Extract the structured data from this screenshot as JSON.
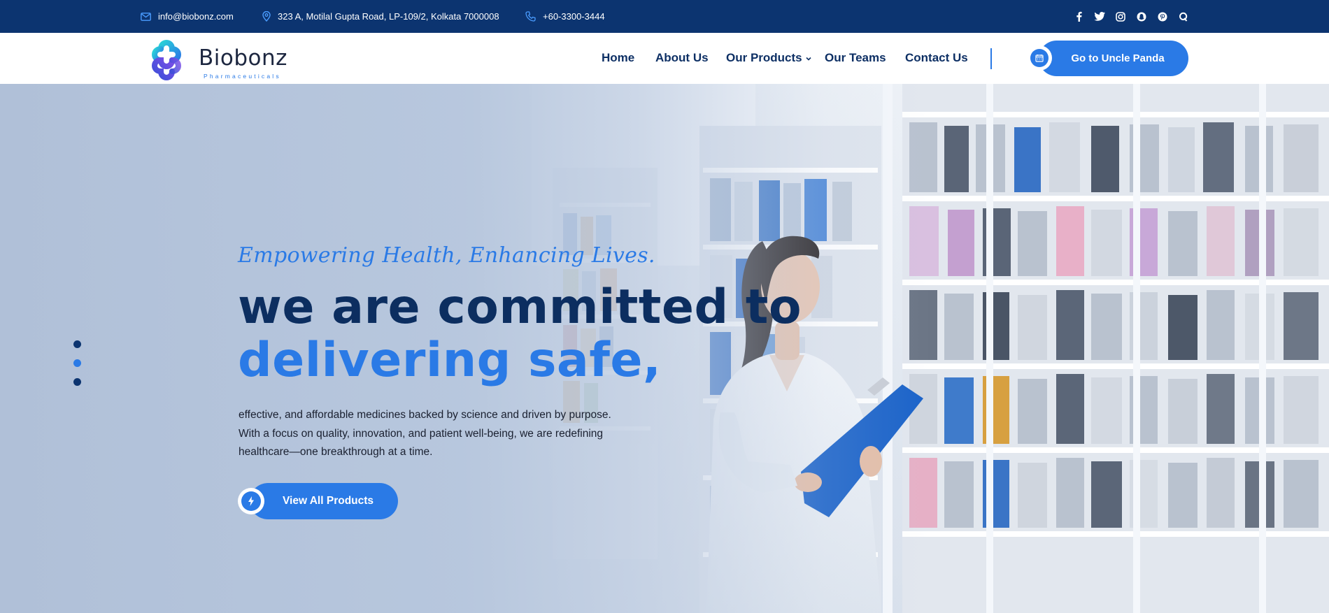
{
  "topbar": {
    "email": "info@biobonz.com",
    "address": "323 A, Motilal Gupta Road, LP-109/2, Kolkata 7000008",
    "phone": "+60-3300-3444",
    "socials": [
      "facebook-icon",
      "twitter-icon",
      "instagram-icon",
      "snapchat-icon",
      "pinterest-icon",
      "quora-icon"
    ]
  },
  "header": {
    "logo_name": "Biobonz",
    "logo_sub": "Pharmaceuticals",
    "nav": {
      "home": "Home",
      "about": "About Us",
      "products": "Our Products",
      "teams": "Our Teams",
      "contact": "Contact Us"
    },
    "cta_label": "Go to Uncle Panda"
  },
  "hero": {
    "tagline": "Empowering Health, Enhancing Lives.",
    "heading_line1": "we are committed to",
    "heading_line2": "delivering safe,",
    "description": "effective, and affordable medicines backed by science and driven by purpose. With a focus on quality, innovation, and patient well-being, we are redefining healthcare—one breakthrough at a time.",
    "button_label": "View All Products",
    "slides": 3
  },
  "colors": {
    "primary_dark": "#0c3470",
    "accent": "#2a7ae6"
  }
}
